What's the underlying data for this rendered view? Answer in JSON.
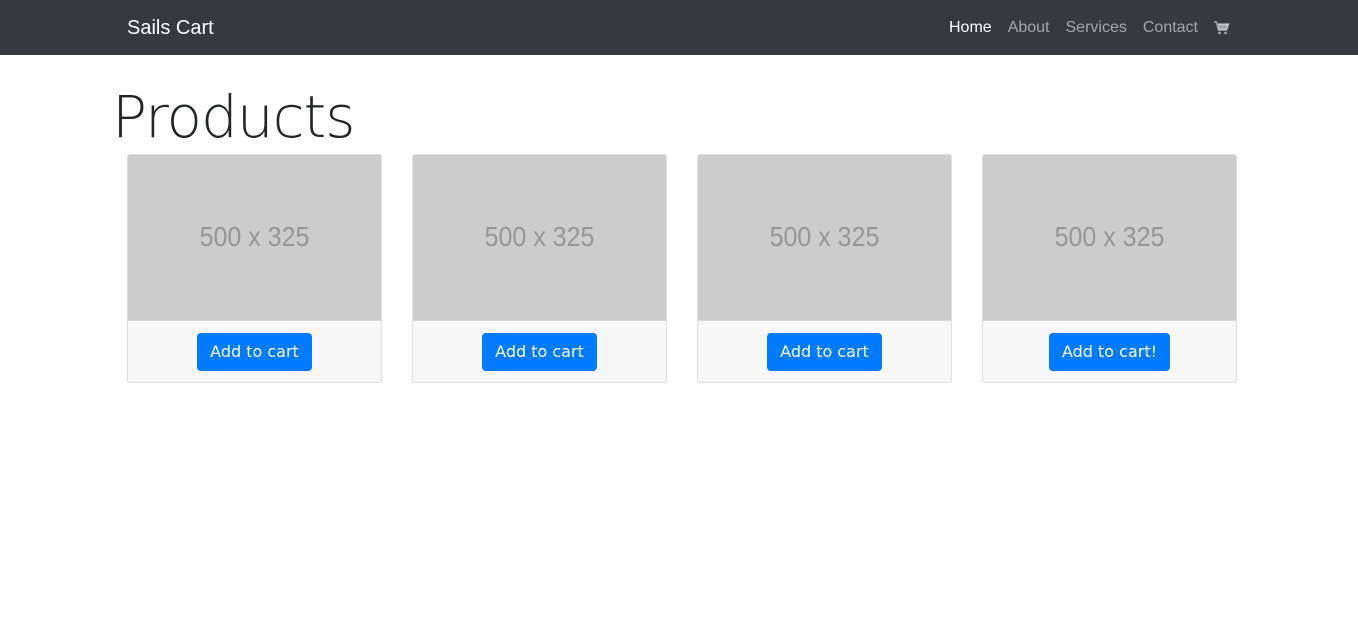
{
  "navbar": {
    "brand": "Sails Cart",
    "links": [
      {
        "label": "Home",
        "active": true
      },
      {
        "label": "About",
        "active": false
      },
      {
        "label": "Services",
        "active": false
      },
      {
        "label": "Contact",
        "active": false
      }
    ],
    "cart_icon": "shopping-cart-icon"
  },
  "main": {
    "title": "Products",
    "products": [
      {
        "image_text": "500 x 325",
        "button_label": "Add to cart"
      },
      {
        "image_text": "500 x 325",
        "button_label": "Add to cart"
      },
      {
        "image_text": "500 x 325",
        "button_label": "Add to cart"
      },
      {
        "image_text": "500 x 325",
        "button_label": "Add to cart!"
      }
    ]
  },
  "colors": {
    "navbar_bg": "#343a40",
    "primary": "#007bff",
    "placeholder_bg": "#cccccc",
    "footer_bg": "#f7f7f7"
  }
}
